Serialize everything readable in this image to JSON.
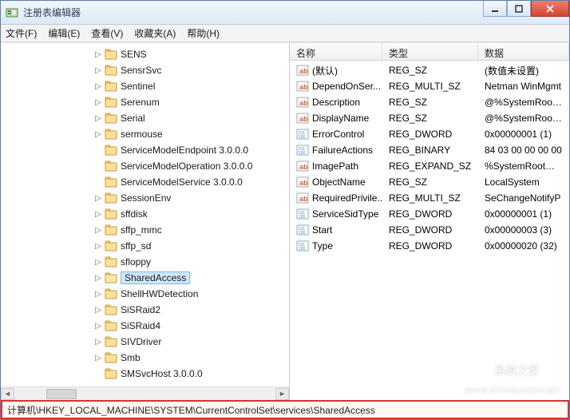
{
  "window": {
    "title": "注册表编辑器"
  },
  "menu": {
    "file": "文件(F)",
    "edit": "编辑(E)",
    "view": "查看(V)",
    "favorites": "收藏夹(A)",
    "help": "帮助(H)"
  },
  "tree_items": [
    {
      "label": "SENS",
      "expandable": true
    },
    {
      "label": "SensrSvc",
      "expandable": true
    },
    {
      "label": "Sentinel",
      "expandable": true
    },
    {
      "label": "Serenum",
      "expandable": true
    },
    {
      "label": "Serial",
      "expandable": true
    },
    {
      "label": "sermouse",
      "expandable": true
    },
    {
      "label": "ServiceModelEndpoint 3.0.0.0",
      "expandable": false
    },
    {
      "label": "ServiceModelOperation 3.0.0.0",
      "expandable": false
    },
    {
      "label": "ServiceModelService 3.0.0.0",
      "expandable": false
    },
    {
      "label": "SessionEnv",
      "expandable": true
    },
    {
      "label": "sffdisk",
      "expandable": true
    },
    {
      "label": "sffp_mmc",
      "expandable": true
    },
    {
      "label": "sffp_sd",
      "expandable": true
    },
    {
      "label": "sfloppy",
      "expandable": true
    },
    {
      "label": "SharedAccess",
      "expandable": true,
      "selected": true
    },
    {
      "label": "ShellHWDetection",
      "expandable": true
    },
    {
      "label": "SiSRaid2",
      "expandable": true
    },
    {
      "label": "SiSRaid4",
      "expandable": true
    },
    {
      "label": "SIVDriver",
      "expandable": true
    },
    {
      "label": "Smb",
      "expandable": true
    },
    {
      "label": "SMSvcHost 3.0.0.0",
      "expandable": false
    }
  ],
  "list": {
    "columns": {
      "name": "名称",
      "type": "类型",
      "data": "数据"
    },
    "rows": [
      {
        "icon": "str",
        "name": "(默认)",
        "type": "REG_SZ",
        "data": "(数值未设置)"
      },
      {
        "icon": "str",
        "name": "DependOnSer...",
        "type": "REG_MULTI_SZ",
        "data": "Netman WinMgmt"
      },
      {
        "icon": "str",
        "name": "Description",
        "type": "REG_SZ",
        "data": "@%SystemRoot%"
      },
      {
        "icon": "str",
        "name": "DisplayName",
        "type": "REG_SZ",
        "data": "@%SystemRoot%"
      },
      {
        "icon": "bin",
        "name": "ErrorControl",
        "type": "REG_DWORD",
        "data": "0x00000001 (1)"
      },
      {
        "icon": "bin",
        "name": "FailureActions",
        "type": "REG_BINARY",
        "data": "84 03 00 00 00 00"
      },
      {
        "icon": "str",
        "name": "ImagePath",
        "type": "REG_EXPAND_SZ",
        "data": "%SystemRoot%\\S"
      },
      {
        "icon": "str",
        "name": "ObjectName",
        "type": "REG_SZ",
        "data": "LocalSystem"
      },
      {
        "icon": "str",
        "name": "RequiredPrivile...",
        "type": "REG_MULTI_SZ",
        "data": "SeChangeNotifyP"
      },
      {
        "icon": "bin",
        "name": "ServiceSidType",
        "type": "REG_DWORD",
        "data": "0x00000001 (1)"
      },
      {
        "icon": "bin",
        "name": "Start",
        "type": "REG_DWORD",
        "data": "0x00000003 (3)"
      },
      {
        "icon": "bin",
        "name": "Type",
        "type": "REG_DWORD",
        "data": "0x00000020 (32)"
      }
    ]
  },
  "status": {
    "path": "计算机\\HKEY_LOCAL_MACHINE\\SYSTEM\\CurrentControlSet\\services\\SharedAccess"
  },
  "watermark": {
    "text": "系统之家",
    "url": "WWW.XITONGZHIJIA.NET"
  }
}
